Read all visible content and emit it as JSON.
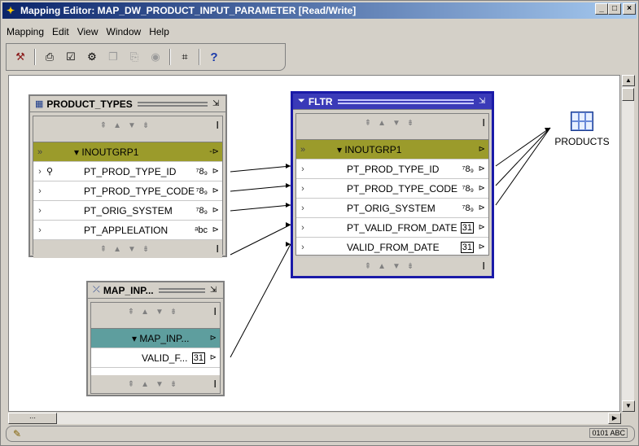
{
  "window": {
    "title": "Mapping Editor: MAP_DW_PRODUCT_INPUT_PARAMETER [Read/Write]",
    "controls": [
      "_",
      "□",
      "×"
    ]
  },
  "menu": {
    "items": [
      {
        "label": "Mapping",
        "mnemonic": "M"
      },
      {
        "label": "Edit",
        "mnemonic": "E"
      },
      {
        "label": "View",
        "mnemonic": "V"
      },
      {
        "label": "Window",
        "mnemonic": "W"
      },
      {
        "label": "Help",
        "mnemonic": "H"
      }
    ]
  },
  "toolbar": {
    "buttons": [
      "properties-icon",
      "print-icon",
      "validate-icon",
      "generate-icon",
      "copy-icon",
      "paste-icon",
      "deploy-icon",
      "tag-icon",
      "help-icon"
    ],
    "help_glyph": "?"
  },
  "operators": {
    "product_types": {
      "title": "PRODUCT_TYPES",
      "group": "INOUTGRP1",
      "rows": [
        {
          "name": "PT_PROD_TYPE_ID",
          "type": "789",
          "key": true
        },
        {
          "name": "PT_PROD_TYPE_CODE",
          "type": "789"
        },
        {
          "name": "PT_ORIG_SYSTEM",
          "type": "789"
        },
        {
          "name": "PT_APPLELATION",
          "type": "abc"
        }
      ]
    },
    "fltr": {
      "title": "FLTR",
      "group": "INOUTGRP1",
      "rows": [
        {
          "name": "PT_PROD_TYPE_ID",
          "type": "789"
        },
        {
          "name": "PT_PROD_TYPE_CODE",
          "type": "789"
        },
        {
          "name": "PT_ORIG_SYSTEM",
          "type": "789"
        },
        {
          "name": "PT_VALID_FROM_DATE",
          "type": "31"
        },
        {
          "name": "VALID_FROM_DATE",
          "type": "31"
        }
      ]
    },
    "map_input": {
      "title": "MAP_INP...",
      "group": "MAP_INP...",
      "rows": [
        {
          "name": "VALID_F...",
          "type": "31"
        }
      ]
    },
    "products": {
      "title": "PRODUCTS"
    }
  },
  "glyphs": {
    "num_type": "⁷8₉",
    "abc_type": "ᵃbc",
    "date_type": "31",
    "expand": "›",
    "port": "⊢",
    "nav": "⇞▲▼⇟"
  },
  "colors": {
    "title_start": "#0a246a",
    "title_end": "#a6caf0",
    "group_row": "#9b9b2b",
    "param_group_row": "#5e9e9e",
    "selected_border": "#1a1aa8"
  }
}
